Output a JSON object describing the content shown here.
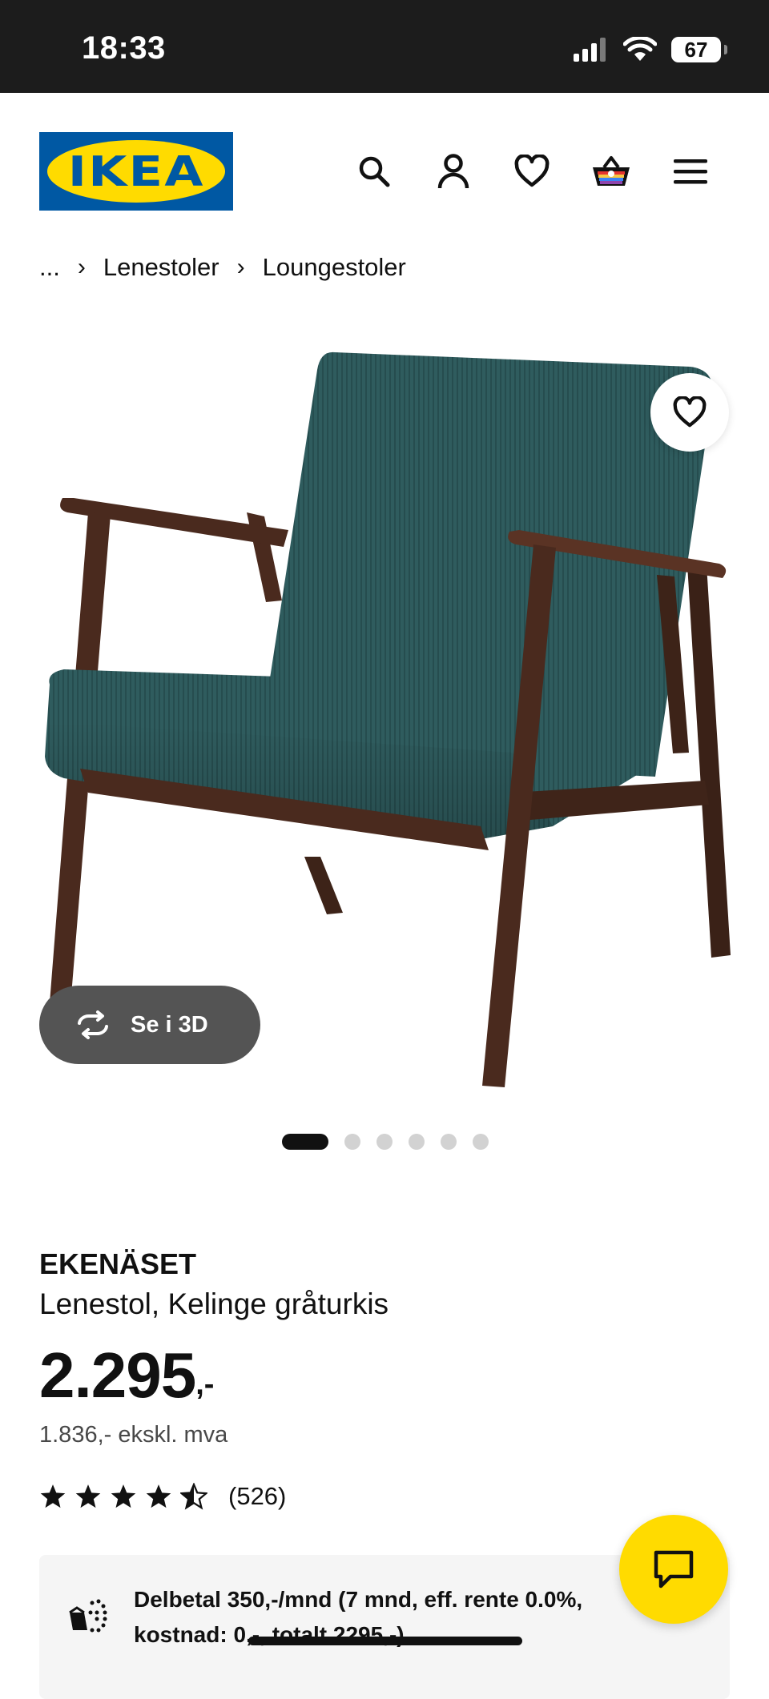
{
  "status_bar": {
    "time": "18:33",
    "battery": "67"
  },
  "header": {
    "logo_text": "IKEA",
    "icons": [
      "search-icon",
      "account-icon",
      "wishlist-icon",
      "cart-icon",
      "menu-icon"
    ]
  },
  "breadcrumb": {
    "ellipsis": "...",
    "items": [
      "Lenestoler",
      "Loungestoler"
    ]
  },
  "gallery": {
    "view_3d_label": "Se i 3D",
    "image_count": 6,
    "active_index": 0
  },
  "product": {
    "name": "EKENÄSET",
    "description": "Lenestol, Kelinge gråturkis",
    "price_integer": "2.295",
    "price_suffix": ",-",
    "price_ex_vat": "1.836,- ekskl. mva",
    "rating_value": 4.5,
    "rating_max": 5,
    "review_count": "(526)"
  },
  "finance": {
    "text": "Delbetal 350,-/mnd (7 mnd, eff. rente 0.0%, kostnad: 0,-, totalt 2295,-)."
  },
  "colors": {
    "ikea_blue": "#0058a3",
    "ikea_yellow": "#ffdb00",
    "fabric": "#2f5c5e",
    "wood": "#4a2a1e"
  }
}
